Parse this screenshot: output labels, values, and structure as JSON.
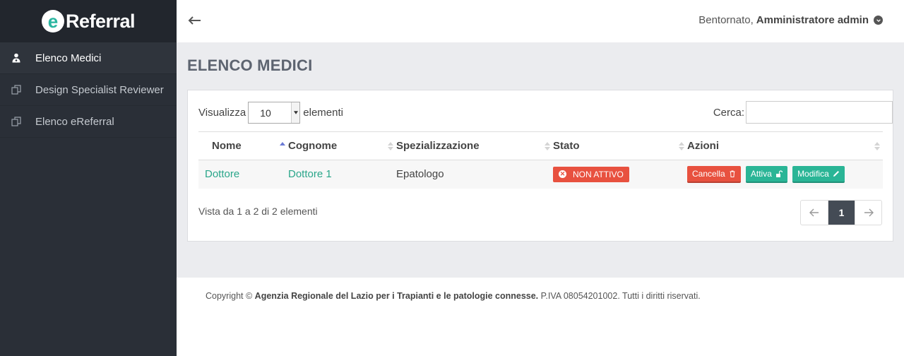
{
  "brand": {
    "logo_letter": "e",
    "logo_text": "Referral",
    "accent": "#2ab5a0"
  },
  "sidebar": {
    "items": [
      {
        "label": "Elenco Medici",
        "icon": "doctor-icon",
        "active": true
      },
      {
        "label": "Design Specialist Reviewer",
        "icon": "copy-icon",
        "active": false
      },
      {
        "label": "Elenco eReferral",
        "icon": "copy-icon",
        "active": false
      }
    ]
  },
  "topbar": {
    "greeting": "Bentornato,",
    "user": "Amministratore admin"
  },
  "page": {
    "title": "ELENCO MEDICI"
  },
  "table_controls": {
    "show_label": "Visualizza",
    "page_size": "10",
    "elements_label": "elementi",
    "search_label": "Cerca:",
    "search_value": ""
  },
  "table": {
    "columns": [
      "Nome",
      "Cognome",
      "Spezializzazione",
      "Stato",
      "Azioni"
    ],
    "rows": [
      {
        "nome": "Dottore",
        "cognome": "Dottore 1",
        "specializzazione": "Epatologo",
        "stato": "NON ATTIVO",
        "actions": {
          "delete": "Cancella",
          "activate": "Attiva",
          "edit": "Modifica"
        }
      }
    ]
  },
  "pagination": {
    "info": "Vista da 1 a 2 di 2 elementi",
    "current_page": "1"
  },
  "footer": {
    "prefix": "Copyright ©",
    "org": "Agenzia Regionale del Lazio per i Trapianti e le patologie connesse.",
    "suffix": "P.IVA 08054201002. Tutti i diritti riservati."
  },
  "colors": {
    "sidebar": "#2a2f37",
    "danger": "#e8513f",
    "success": "#2ab596",
    "link": "#2aa68a"
  }
}
